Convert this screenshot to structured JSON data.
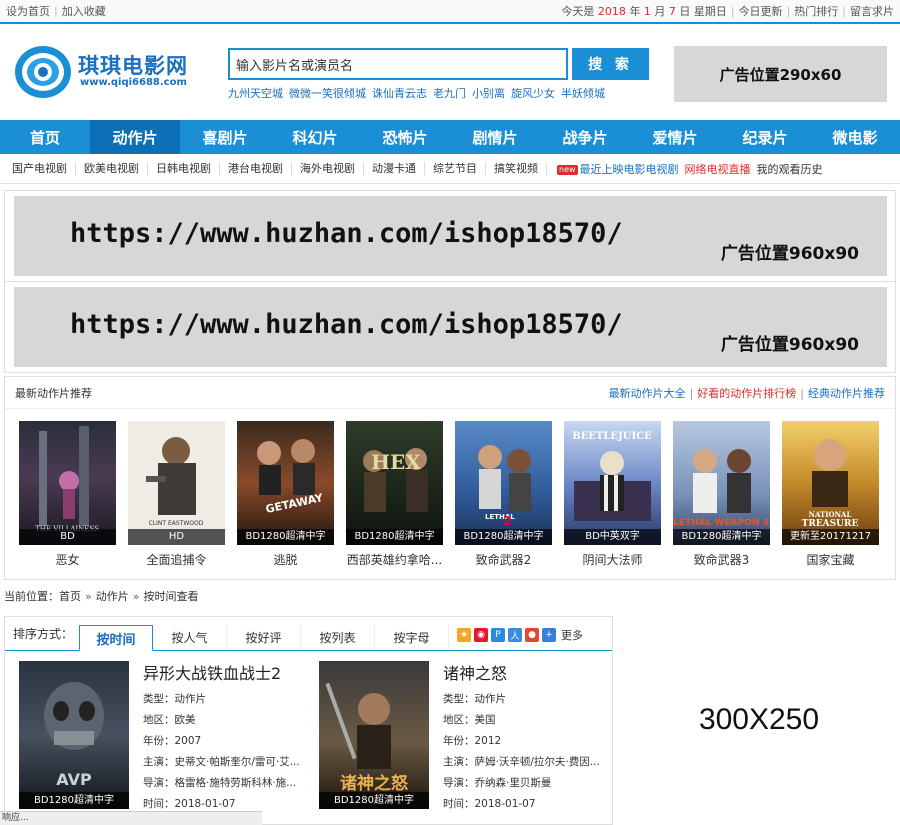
{
  "topbar": {
    "set_home": "设为首页",
    "favorite": "加入收藏",
    "date_prefix": "今天是",
    "year": "2018",
    "year_unit": "年",
    "month": "1",
    "month_unit": "月",
    "day": "7",
    "day_unit": "日",
    "weekday": "星期日",
    "links": [
      "今日更新",
      "热门排行",
      "留言求片"
    ]
  },
  "header": {
    "logo_text": "琪琪电影网",
    "logo_url": "www.qiqi6688.com",
    "search_placeholder": "输入影片名或演员名",
    "search_button": "搜 索",
    "hot_links": [
      "九州天空城",
      "微微一笑很倾城",
      "诛仙青云志",
      "老九门",
      "小别离",
      "旋风少女",
      "半妖倾城"
    ],
    "ad_label": "广告位置290x60",
    "brand_color": "#1a8fd6"
  },
  "nav": [
    "首页",
    "动作片",
    "喜剧片",
    "科幻片",
    "恐怖片",
    "剧情片",
    "战争片",
    "爱情片",
    "纪录片",
    "微电影"
  ],
  "nav_active_index": 1,
  "subnav": {
    "items": [
      "国产电视剧",
      "欧美电视剧",
      "日韩电视剧",
      "港台电视剧",
      "海外电视剧",
      "动漫卡通",
      "综艺节目",
      "搞笑视频"
    ],
    "new_badge": "new",
    "latest_tv": "最近上映电影电视剧",
    "live_tv": "网络电视直播",
    "history": "我的观看历史"
  },
  "ads": [
    {
      "url": "https://www.huzhan.com/ishop18570/",
      "size": "广告位置960x90"
    },
    {
      "url": "https://www.huzhan.com/ishop18570/",
      "size": "广告位置960x90"
    }
  ],
  "recommend": {
    "title": "最新动作片推荐",
    "links": [
      "最新动作片大全",
      "好看的动作片排行榜",
      "经典动作片推荐"
    ],
    "movies": [
      {
        "title": "恶女",
        "badge": "BD"
      },
      {
        "title": "全面追捕令",
        "badge": "HD"
      },
      {
        "title": "逃脱",
        "badge": "BD1280超清中字"
      },
      {
        "title": "西部英雄约拿哈...",
        "badge": "BD1280超清中字"
      },
      {
        "title": "致命武器2",
        "badge": "BD1280超清中字"
      },
      {
        "title": "阴间大法师",
        "badge": "BD中英双字"
      },
      {
        "title": "致命武器3",
        "badge": "BD1280超清中字"
      },
      {
        "title": "国家宝藏",
        "badge": "更新至20171217"
      }
    ]
  },
  "breadcrumb": {
    "label": "当前位置：",
    "items": [
      "首页",
      "动作片",
      "按时间查看"
    ]
  },
  "sort": {
    "label": "排序方式：",
    "tabs": [
      "按时间",
      "按人气",
      "按好评",
      "按列表",
      "按字母"
    ],
    "more": "更多"
  },
  "films": [
    {
      "title": "异形大战铁血战士2",
      "type": "类型：动作片",
      "region": "地区：欧美",
      "year": "年份：2007",
      "cast": "主演：史蒂文·帕斯奎尔/雷可·艾...",
      "director": "导演：格雷格·施特劳斯科林·施...",
      "time": "时间：2018-01-07",
      "badge": "BD1280超清中字"
    },
    {
      "title": "诸神之怒",
      "type": "类型：动作片",
      "region": "地区：美国",
      "year": "年份：2012",
      "cast": "主演：萨姆·沃辛顿/拉尔夫·费因...",
      "director": "导演：乔纳森·里贝斯曼",
      "time": "时间：2018-01-07",
      "badge": "BD1280超清中字"
    }
  ],
  "side_ad": "300X250",
  "status": "响应..."
}
